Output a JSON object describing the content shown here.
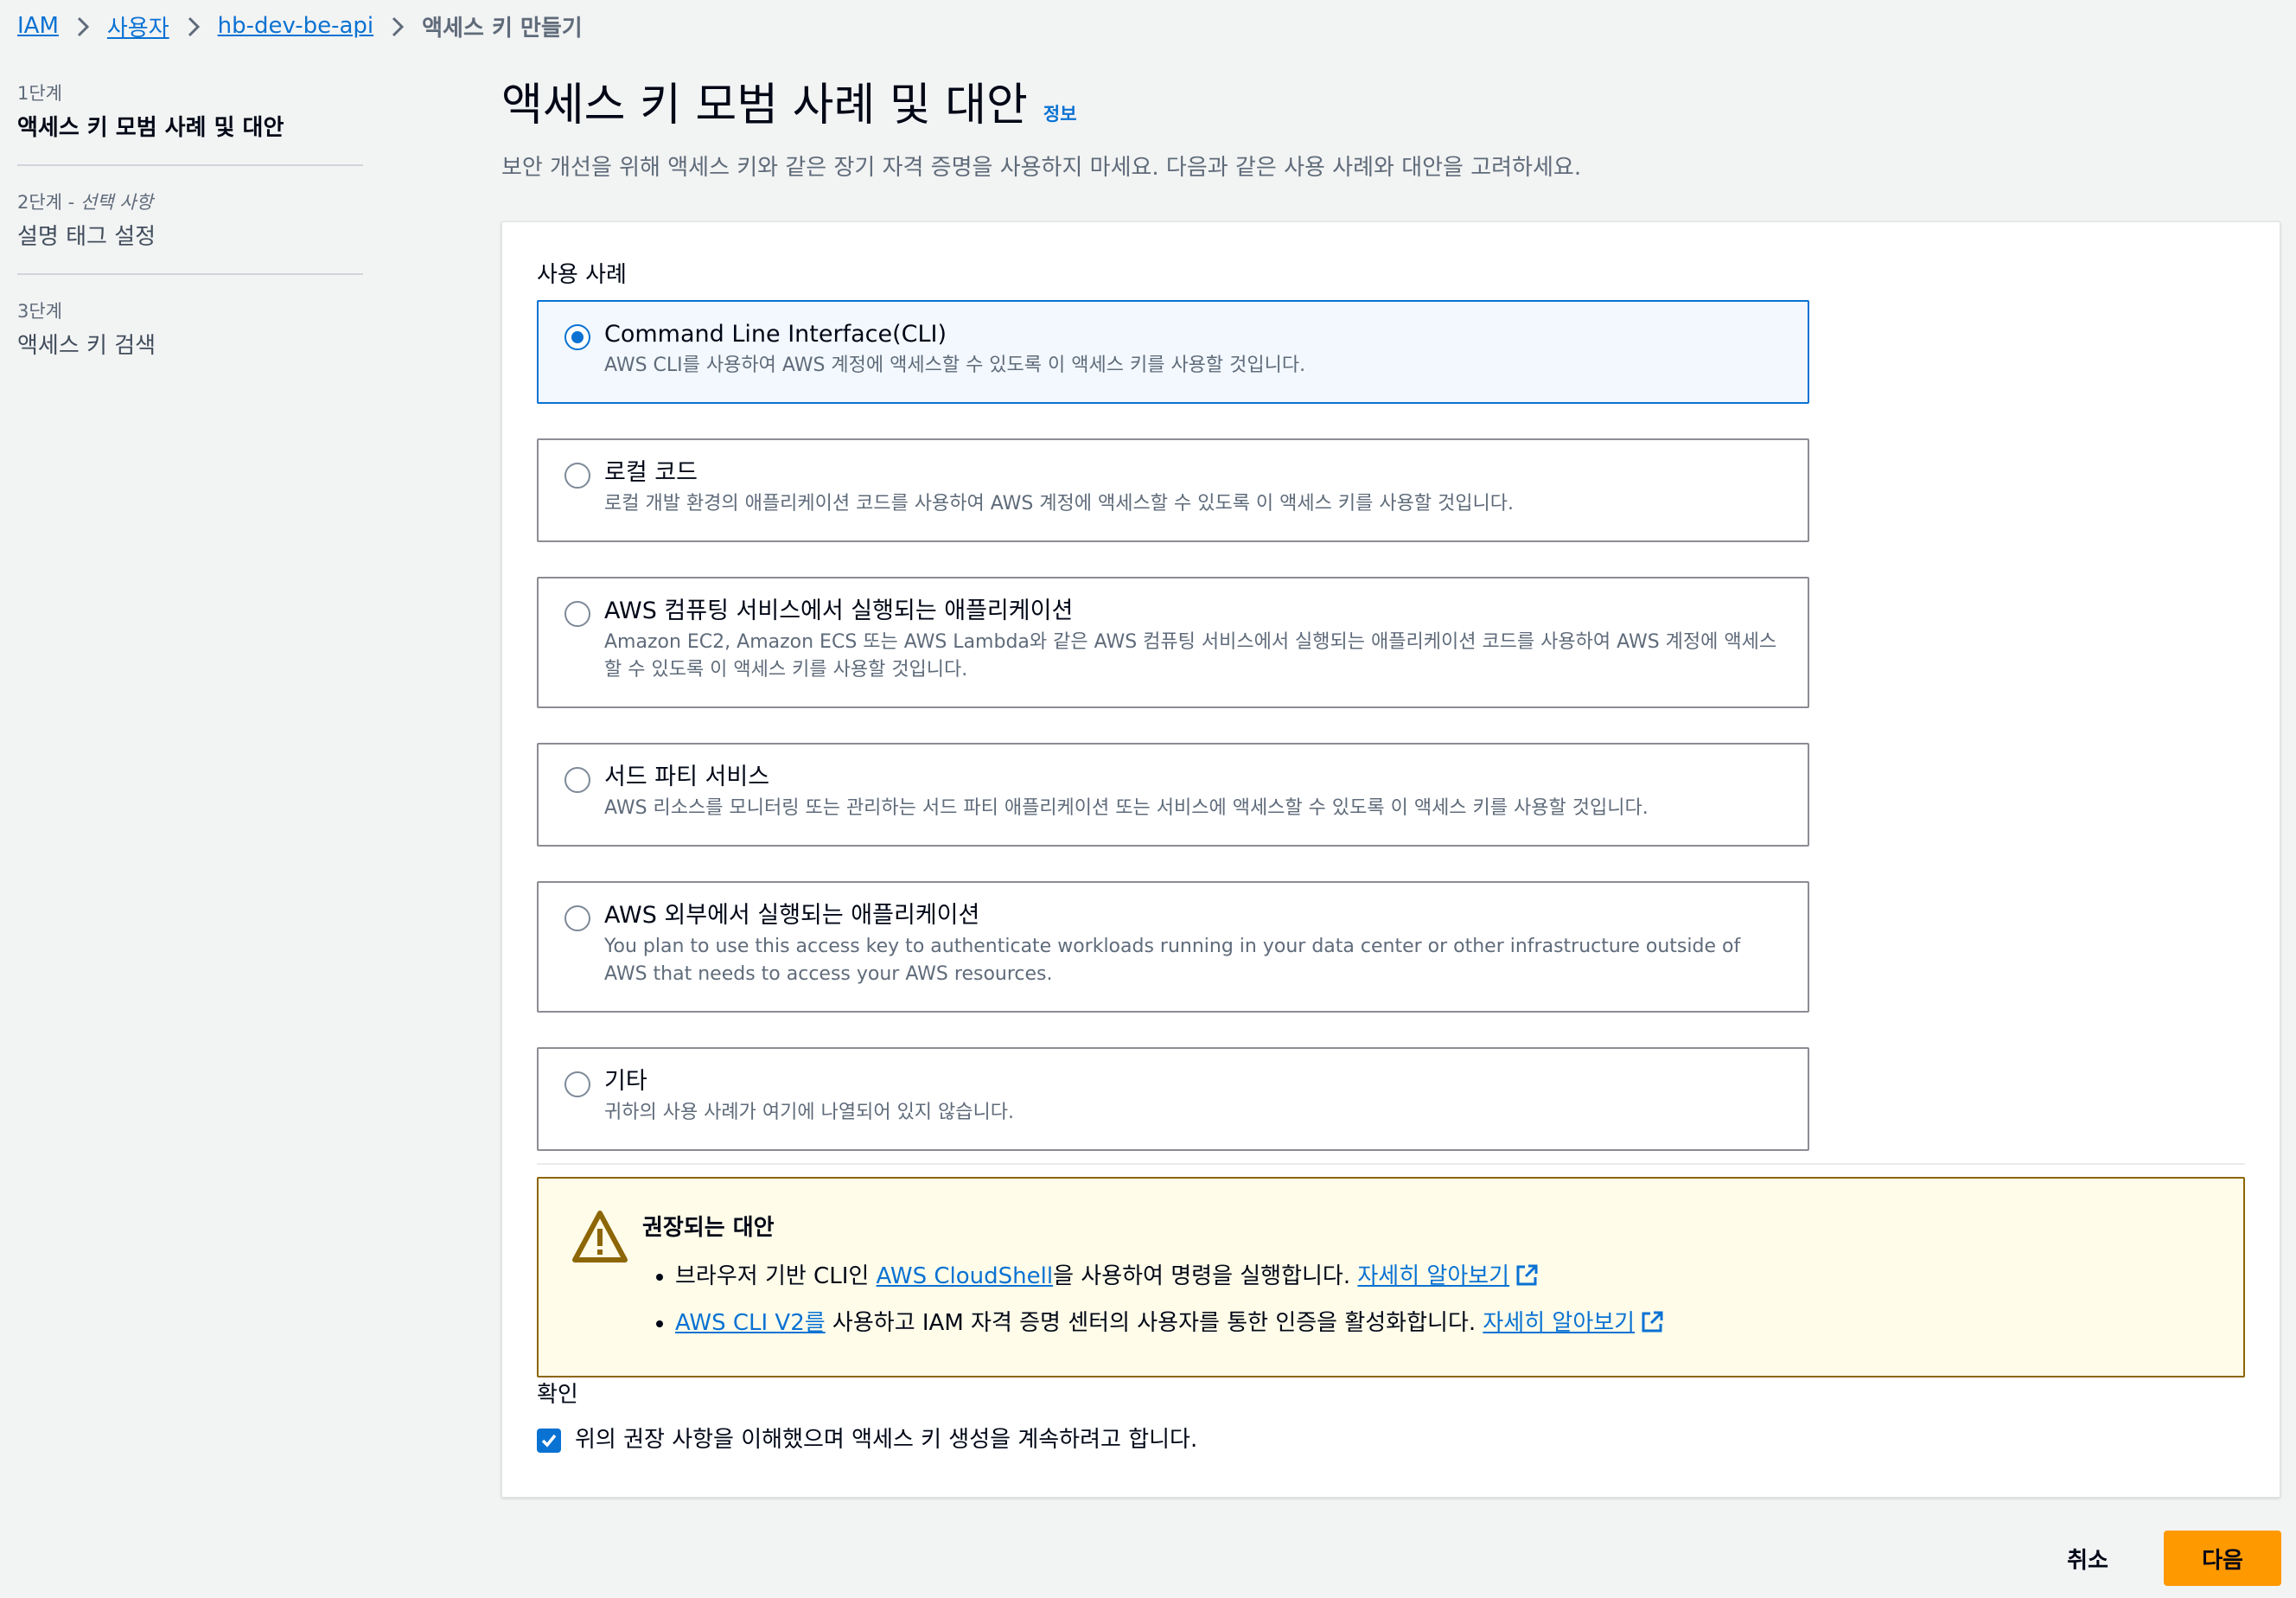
{
  "breadcrumb": {
    "items": [
      "IAM",
      "사용자",
      "hb-dev-be-api"
    ],
    "current": "액세스 키 만들기"
  },
  "steps": [
    {
      "num": "1단계",
      "title": "액세스 키 모범 사례 및 대안",
      "active": true
    },
    {
      "num": "2단계 - ",
      "optional": "선택 사항",
      "title": "설명 태그 설정",
      "active": false
    },
    {
      "num": "3단계",
      "title": "액세스 키 검색",
      "active": false
    }
  ],
  "page": {
    "title": "액세스 키 모범 사례 및 대안",
    "info_link": "정보",
    "description": "보안 개선을 위해 액세스 키와 같은 장기 자격 증명을 사용하지 마세요. 다음과 같은 사용 사례와 대안을 고려하세요."
  },
  "use_case_label": "사용 사례",
  "options": [
    {
      "title": "Command Line Interface(CLI)",
      "desc": "AWS CLI를 사용하여 AWS 계정에 액세스할 수 있도록 이 액세스 키를 사용할 것입니다.",
      "selected": true
    },
    {
      "title": "로컬 코드",
      "desc": "로컬 개발 환경의 애플리케이션 코드를 사용하여 AWS 계정에 액세스할 수 있도록 이 액세스 키를 사용할 것입니다.",
      "selected": false
    },
    {
      "title": "AWS 컴퓨팅 서비스에서 실행되는 애플리케이션",
      "desc": "Amazon EC2, Amazon ECS 또는 AWS Lambda와 같은 AWS 컴퓨팅 서비스에서 실행되는 애플리케이션 코드를 사용하여 AWS 계정에 액세스할 수 있도록 이 액세스 키를 사용할 것입니다.",
      "selected": false
    },
    {
      "title": "서드 파티 서비스",
      "desc": "AWS 리소스를 모니터링 또는 관리하는 서드 파티 애플리케이션 또는 서비스에 액세스할 수 있도록 이 액세스 키를 사용할 것입니다.",
      "selected": false
    },
    {
      "title": "AWS 외부에서 실행되는 애플리케이션",
      "desc": "You plan to use this access key to authenticate workloads running in your data center or other infrastructure outside of AWS that needs to access your AWS resources.",
      "selected": false
    },
    {
      "title": "기타",
      "desc": "귀하의 사용 사례가 여기에 나열되어 있지 않습니다.",
      "selected": false
    }
  ],
  "alert": {
    "title": "권장되는 대안",
    "item1": {
      "pre": "브라우저 기반 CLI인 ",
      "link": "AWS CloudShell",
      "post": "을 사용하여 명령을 실행합니다. ",
      "learn": "자세히 알아보기"
    },
    "item2": {
      "link": "AWS CLI V2를",
      "post": " 사용하고 IAM 자격 증명 센터의 사용자를 통한 인증을 활성화합니다. ",
      "learn": "자세히 알아보기"
    }
  },
  "confirm": {
    "label": "확인",
    "checkbox_text": "위의 권장 사항을 이해했으며 액세스 키 생성을 계속하려고 합니다.",
    "checked": true
  },
  "actions": {
    "cancel": "취소",
    "next": "다음"
  },
  "colors": {
    "accent": "#0972d3",
    "primary_button": "#ff9900",
    "warning_border": "#8d6605",
    "warning_bg": "#fffce9"
  },
  "icons": [
    "chevron-right-icon",
    "warning-icon",
    "external-link-icon",
    "check-icon"
  ]
}
